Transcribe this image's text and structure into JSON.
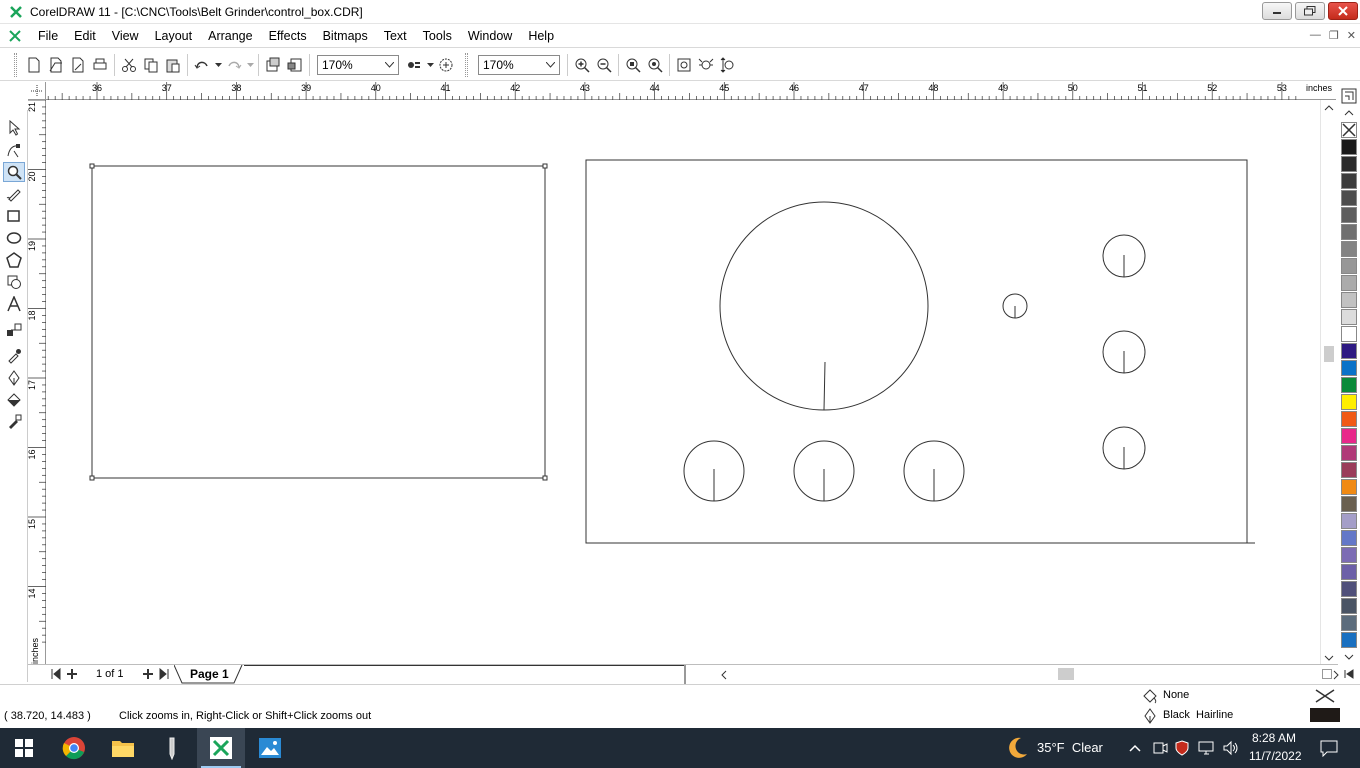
{
  "window": {
    "title": "CorelDRAW 11 - [C:\\CNC\\Tools\\Belt Grinder\\control_box.CDR]"
  },
  "menu": {
    "items": [
      "File",
      "Edit",
      "View",
      "Layout",
      "Arrange",
      "Effects",
      "Bitmaps",
      "Text",
      "Tools",
      "Window",
      "Help"
    ]
  },
  "toolbar": {
    "zoom_level_1": "170%",
    "zoom_level_2": "170%"
  },
  "rulers": {
    "units": "inches",
    "horizontal_ticks": [
      "36",
      "37",
      "38",
      "39",
      "40",
      "41",
      "42",
      "43",
      "44",
      "45",
      "46",
      "47",
      "48",
      "49",
      "50",
      "51",
      "52",
      "53"
    ],
    "vertical_ticks": [
      "21",
      "20",
      "19",
      "18",
      "17",
      "16",
      "15",
      "14"
    ]
  },
  "pages": {
    "counter": "1 of 1",
    "active_tab": "Page 1"
  },
  "status": {
    "coordinates": "( 38.720, 14.483 )",
    "hint": "Click zooms in, Right-Click or Shift+Click zooms out",
    "fill_label": "None",
    "outline_label": "Black  Hairline"
  },
  "palette": {
    "colors": [
      "#1a1a1a",
      "#2b2b2b",
      "#3c3c3c",
      "#4d4d4d",
      "#5e5e5e",
      "#707070",
      "#838383",
      "#979797",
      "#ababab",
      "#c2c2c2",
      "#dcdcdc",
      "#ffffff",
      "#2e1a82",
      "#0a72c8",
      "#0a8a3a",
      "#ffee00",
      "#f05a16",
      "#e8288a",
      "#b03a78",
      "#9a3c5a",
      "#f08a14",
      "#6a6050",
      "#a49ec8",
      "#6478c8",
      "#7c6cb4",
      "#6c60a8",
      "#50507a",
      "#4a5464",
      "#5c6c7c",
      "#1a70c0"
    ]
  },
  "taskbar": {
    "weather": "35°F  Clear",
    "time": "8:28 AM",
    "date": "11/7/2022"
  }
}
